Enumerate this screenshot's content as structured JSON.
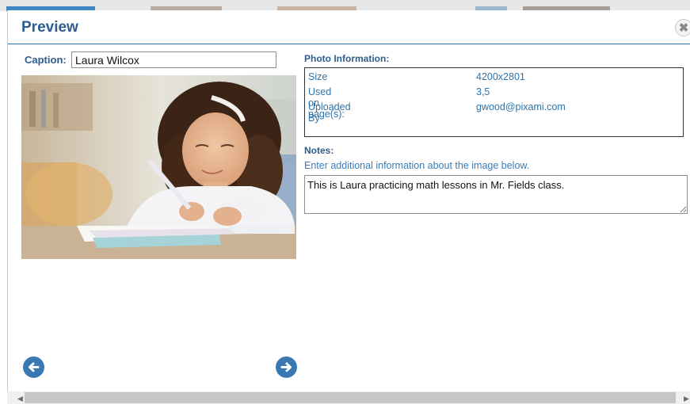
{
  "modal": {
    "title": "Preview",
    "close_icon": "close-icon",
    "caption_label": "Caption:",
    "caption_value": "Laura Wilcox",
    "photo_icon": "photo-girl-writing",
    "prev_icon": "arrow-left-circle-icon",
    "next_icon": "arrow-right-circle-icon"
  },
  "photo_info": {
    "title": "Photo Information:",
    "rows": [
      {
        "label": "Size",
        "value": "4200x2801"
      },
      {
        "label": "Used on page(s):",
        "value": "3,5"
      },
      {
        "label": "Uploaded By",
        "value": "gwood@pixami.com"
      }
    ]
  },
  "notes": {
    "title": "Notes:",
    "hint": "Enter additional information about the image below.",
    "value": "This is Laura practicing math lessons in Mr. Fields class."
  },
  "colors": {
    "accent": "#2d5d8e",
    "link_blue": "#2f73a8",
    "button_blue": "#3a78b3"
  }
}
